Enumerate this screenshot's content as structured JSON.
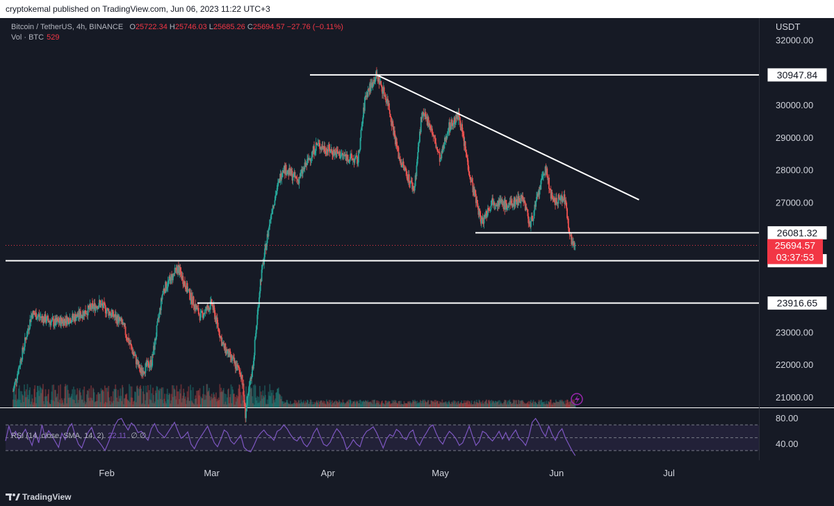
{
  "header": {
    "published": "cryptokemal published on TradingView.com, Jun 06, 2023 11:22 UTC+3"
  },
  "legend": {
    "symbol": "Bitcoin / TetherUS, 4h, BINANCE",
    "o_label": "O",
    "o": "25722.34",
    "h_label": "H",
    "h": "25746.03",
    "l_label": "L",
    "l": "25685.26",
    "c_label": "C",
    "c": "25694.57",
    "change": "−27.76 (−0.11%)",
    "vol_label": "Vol · BTC",
    "vol": "529"
  },
  "rsi_legend": {
    "label": "RSI (14, close, SMA, 14, 2)",
    "value": "22.11",
    "extra": "∅  ∅"
  },
  "footer": {
    "brand": "TradingView"
  },
  "colors": {
    "bg": "#161a25",
    "up": "#26a69a",
    "down": "#ef5350",
    "rsi": "#7e57c2",
    "line": "#ffffff",
    "price_tag": "#f23645"
  },
  "chart_data": {
    "type": "candlestick",
    "symbol": "BTCUSDT",
    "timeframe": "4h",
    "currency": "USDT",
    "y_ticks": [
      "32000.00",
      "30000.00",
      "29000.00",
      "28000.00",
      "27000.00",
      "23000.00",
      "22000.00",
      "21000.00"
    ],
    "x_ticks": [
      "Feb",
      "Mar",
      "Apr",
      "May",
      "Jun",
      "Jul"
    ],
    "ylim": [
      20700,
      32700
    ],
    "price_path": [
      [
        "2023-01-07",
        21200
      ],
      [
        "2023-01-12",
        23600
      ],
      [
        "2023-01-18",
        23300
      ],
      [
        "2023-01-24",
        23500
      ],
      [
        "2023-01-30",
        23900
      ],
      [
        "2023-02-05",
        23300
      ],
      [
        "2023-02-10",
        21800
      ],
      [
        "2023-02-13",
        22100
      ],
      [
        "2023-02-16",
        24300
      ],
      [
        "2023-02-20",
        25000
      ],
      [
        "2023-02-23",
        24200
      ],
      [
        "2023-02-26",
        23500
      ],
      [
        "2023-03-01",
        23900
      ],
      [
        "2023-03-04",
        22600
      ],
      [
        "2023-03-09",
        21700
      ],
      [
        "2023-03-10",
        20500
      ],
      [
        "2023-03-12",
        22000
      ],
      [
        "2023-03-14",
        24600
      ],
      [
        "2023-03-17",
        26800
      ],
      [
        "2023-03-20",
        28100
      ],
      [
        "2023-03-24",
        27700
      ],
      [
        "2023-03-29",
        28800
      ],
      [
        "2023-04-04",
        28500
      ],
      [
        "2023-04-09",
        28300
      ],
      [
        "2023-04-11",
        30300
      ],
      [
        "2023-04-14",
        30950
      ],
      [
        "2023-04-17",
        30100
      ],
      [
        "2023-04-20",
        28400
      ],
      [
        "2023-04-24",
        27400
      ],
      [
        "2023-04-26",
        29700
      ],
      [
        "2023-04-28",
        29500
      ],
      [
        "2023-05-01",
        28300
      ],
      [
        "2023-05-03",
        29300
      ],
      [
        "2023-05-06",
        29700
      ],
      [
        "2023-05-09",
        27800
      ],
      [
        "2023-05-12",
        26400
      ],
      [
        "2023-05-15",
        27100
      ],
      [
        "2023-05-19",
        26900
      ],
      [
        "2023-05-23",
        27200
      ],
      [
        "2023-05-25",
        26300
      ],
      [
        "2023-05-29",
        28100
      ],
      [
        "2023-05-31",
        27000
      ],
      [
        "2023-06-03",
        27200
      ],
      [
        "2023-06-05",
        25800
      ],
      [
        "2023-06-06",
        25694.57
      ]
    ],
    "horizontal_lines": [
      {
        "value": 30947.84,
        "label": "30947.84"
      },
      {
        "value": 26081.32,
        "label": "26081.32"
      },
      {
        "value": 25222.19,
        "label": "25222.19"
      },
      {
        "value": 23916.65,
        "label": "23916.65"
      }
    ],
    "trendline": {
      "from": [
        "2023-04-14",
        30950
      ],
      "to": [
        "2023-06-23",
        27100
      ]
    },
    "last_price": {
      "value": "25694.57",
      "countdown": "03:37:53"
    },
    "rsi": {
      "ticks": [
        "80.00",
        "40.00"
      ],
      "bands": [
        70,
        50,
        30
      ],
      "values": [
        45,
        68,
        52,
        60,
        48,
        55,
        63,
        50,
        38,
        58,
        42,
        70,
        49,
        61,
        53,
        44,
        35,
        57,
        47,
        65,
        72,
        54,
        40,
        34,
        48,
        59,
        66,
        51,
        45,
        38,
        30,
        42,
        55,
        69,
        78,
        80,
        70,
        62,
        73,
        68,
        58,
        60,
        52,
        46,
        64,
        72,
        60,
        55,
        50,
        58,
        66,
        74,
        61,
        49,
        53,
        59,
        40,
        33,
        44,
        52,
        60,
        68,
        55,
        42,
        36,
        48,
        62,
        58,
        45,
        40,
        47,
        54,
        35,
        30,
        28,
        38,
        50,
        57,
        62,
        55,
        52,
        46,
        60,
        63,
        70,
        64,
        55,
        48,
        45,
        52,
        41,
        36,
        44,
        57,
        65,
        52,
        40,
        37,
        43,
        55,
        64,
        58,
        48,
        32,
        38,
        47,
        40,
        36,
        52,
        60,
        63,
        67,
        58,
        46,
        34,
        48,
        55,
        52,
        63,
        59,
        50,
        47,
        58,
        62,
        45,
        38,
        49,
        57,
        66,
        70,
        57,
        46,
        40,
        52,
        60,
        55,
        48,
        38,
        42,
        55,
        68,
        52,
        38,
        44,
        60,
        57,
        50,
        45,
        52,
        60,
        48,
        58,
        46,
        55,
        62,
        50,
        45,
        38,
        52,
        74,
        80,
        72,
        60,
        52,
        68,
        55,
        46,
        58,
        64,
        50,
        40,
        30,
        22.11
      ]
    }
  }
}
